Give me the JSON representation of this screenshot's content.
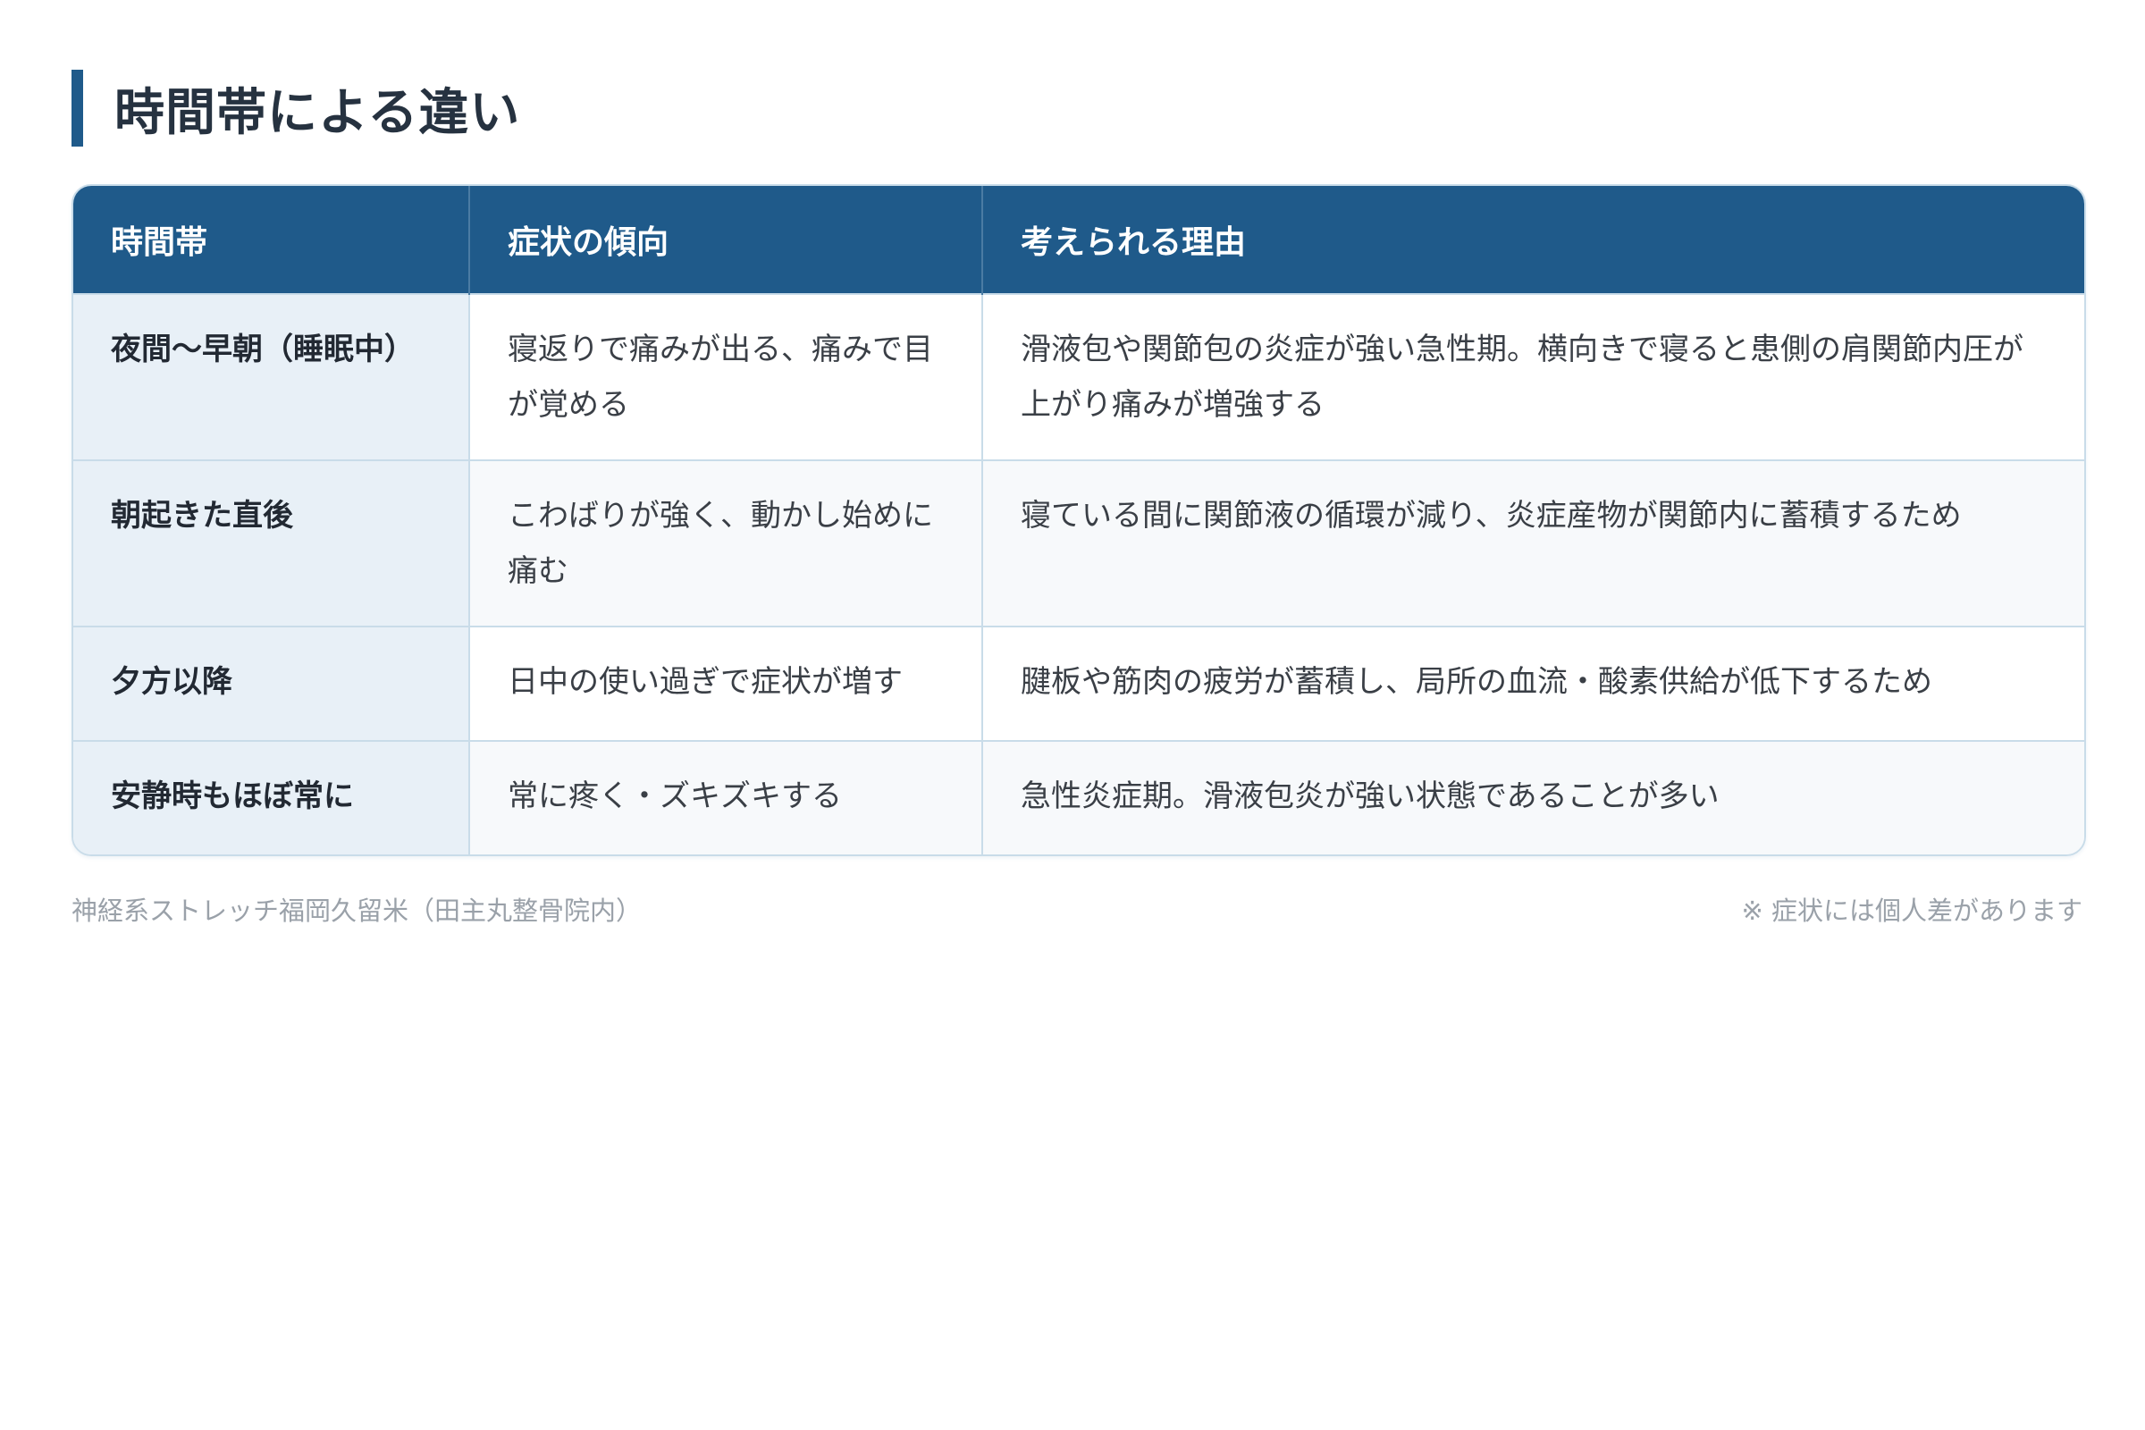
{
  "heading": "時間帯による違い",
  "table": {
    "columns": [
      "時間帯",
      "症状の傾向",
      "考えられる理由"
    ],
    "rows": [
      {
        "time": "夜間〜早朝（睡眠中）",
        "symptom": "寝返りで痛みが出る、痛みで目が覚める",
        "reason": "滑液包や関節包の炎症が強い急性期。横向きで寝ると患側の肩関節内圧が上がり痛みが増強する"
      },
      {
        "time": "朝起きた直後",
        "symptom": "こわばりが強く、動かし始めに痛む",
        "reason": "寝ている間に関節液の循環が減り、炎症産物が関節内に蓄積するため"
      },
      {
        "time": "夕方以降",
        "symptom": "日中の使い過ぎで症状が増す",
        "reason": "腱板や筋肉の疲労が蓄積し、局所の血流・酸素供給が低下するため"
      },
      {
        "time": "安静時もほぼ常に",
        "symptom": "常に疼く・ズキズキする",
        "reason": "急性炎症期。滑液包炎が強い状態であることが多い"
      }
    ]
  },
  "footer": {
    "source": "神経系ストレッチ福岡久留米（田主丸整骨院内）",
    "note": "※ 症状には個人差があります"
  },
  "colors": {
    "accent": "#1f5a8a",
    "label_bg": "#e8f0f7",
    "border": "#c9dce9"
  }
}
